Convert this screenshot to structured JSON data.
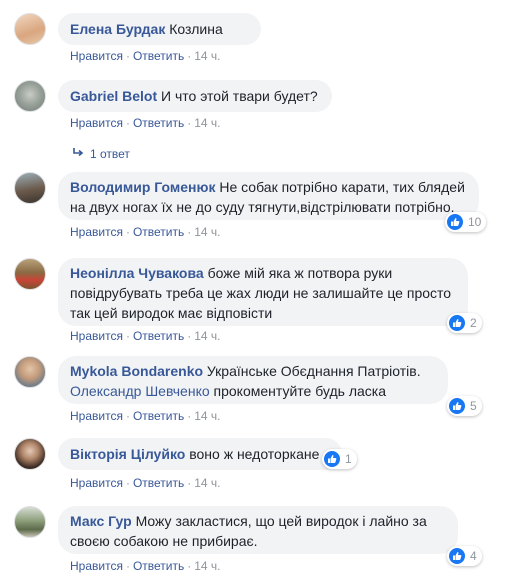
{
  "ui": {
    "like": "Нравится",
    "reply": "Ответить",
    "dot": "·",
    "replies_link": "1 ответ",
    "like_icon": "thumbs-up-icon",
    "reply_icon": "reply-arrow-icon",
    "accent_color": "#385898",
    "like_color": "#1877f2"
  },
  "comments": [
    {
      "author": "Елена Бурдак",
      "text": "Козлина",
      "time": "14 ч."
    },
    {
      "author": "Gabriel Belot",
      "text": "И что этой твари будет?",
      "time": "14 ч."
    },
    {
      "author": "Володимир Гоменюк",
      "text": "Не собак потрібно карати, тих блядей на двух ногах їх не до суду тягнути,відстрілювати потрібно.",
      "time": "14 ч.",
      "likes": "10"
    },
    {
      "author": "Неонілла Чувакова",
      "text": "боже мій яка ж потвора руки повідрубувать треба це жах люди не залишайте це просто так цей виродок має відповісти",
      "time": "14 ч.",
      "likes": "2"
    },
    {
      "author": "Mykola Bondarenko",
      "text": "Українське Обєднання Патріотів.",
      "mention": "Олександр Шевченко",
      "text2": "прокоментуйте будь ласка",
      "time": "14 ч.",
      "likes": "5"
    },
    {
      "author": "Вікторія Цілуйко",
      "text": "воно ж недоторкане",
      "time": "14 ч.",
      "likes": "1"
    },
    {
      "author": "Макс Гур",
      "text": "Можу закластися, що цей виродок і лайно за своєю собакою не прибирає.",
      "time": "14 ч.",
      "likes": "4"
    }
  ]
}
